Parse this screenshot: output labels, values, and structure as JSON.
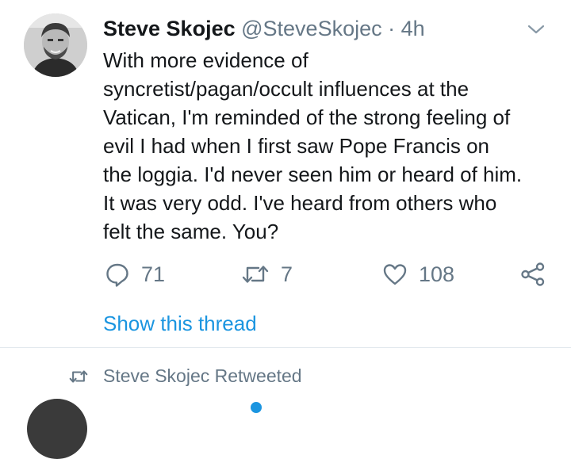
{
  "tweet": {
    "author_name": "Steve Skojec",
    "handle": "@SteveSkojec",
    "separator": "·",
    "time": "4h",
    "text": "With more evidence of\nsyncretist/pagan/occult influences at the\nVatican, I'm reminded of the strong feeling of\nevil I had when I first saw Pope Francis on\nthe loggia. I'd never seen him or heard of him.\nIt was very odd. I've heard from others who\nfelt the same. You?",
    "actions": {
      "reply_count": "71",
      "retweet_count": "7",
      "like_count": "108"
    },
    "show_thread_label": "Show this thread"
  },
  "next_item": {
    "retweeted_label": "Steve Skojec Retweeted"
  },
  "icons": {
    "caret": "chevron-down-icon",
    "reply": "reply-icon",
    "retweet": "retweet-icon",
    "like": "heart-icon",
    "share": "share-icon"
  },
  "colors": {
    "text": "#14171a",
    "secondary": "#657786",
    "link": "#1b95e0",
    "divider": "#e1e8ed"
  }
}
